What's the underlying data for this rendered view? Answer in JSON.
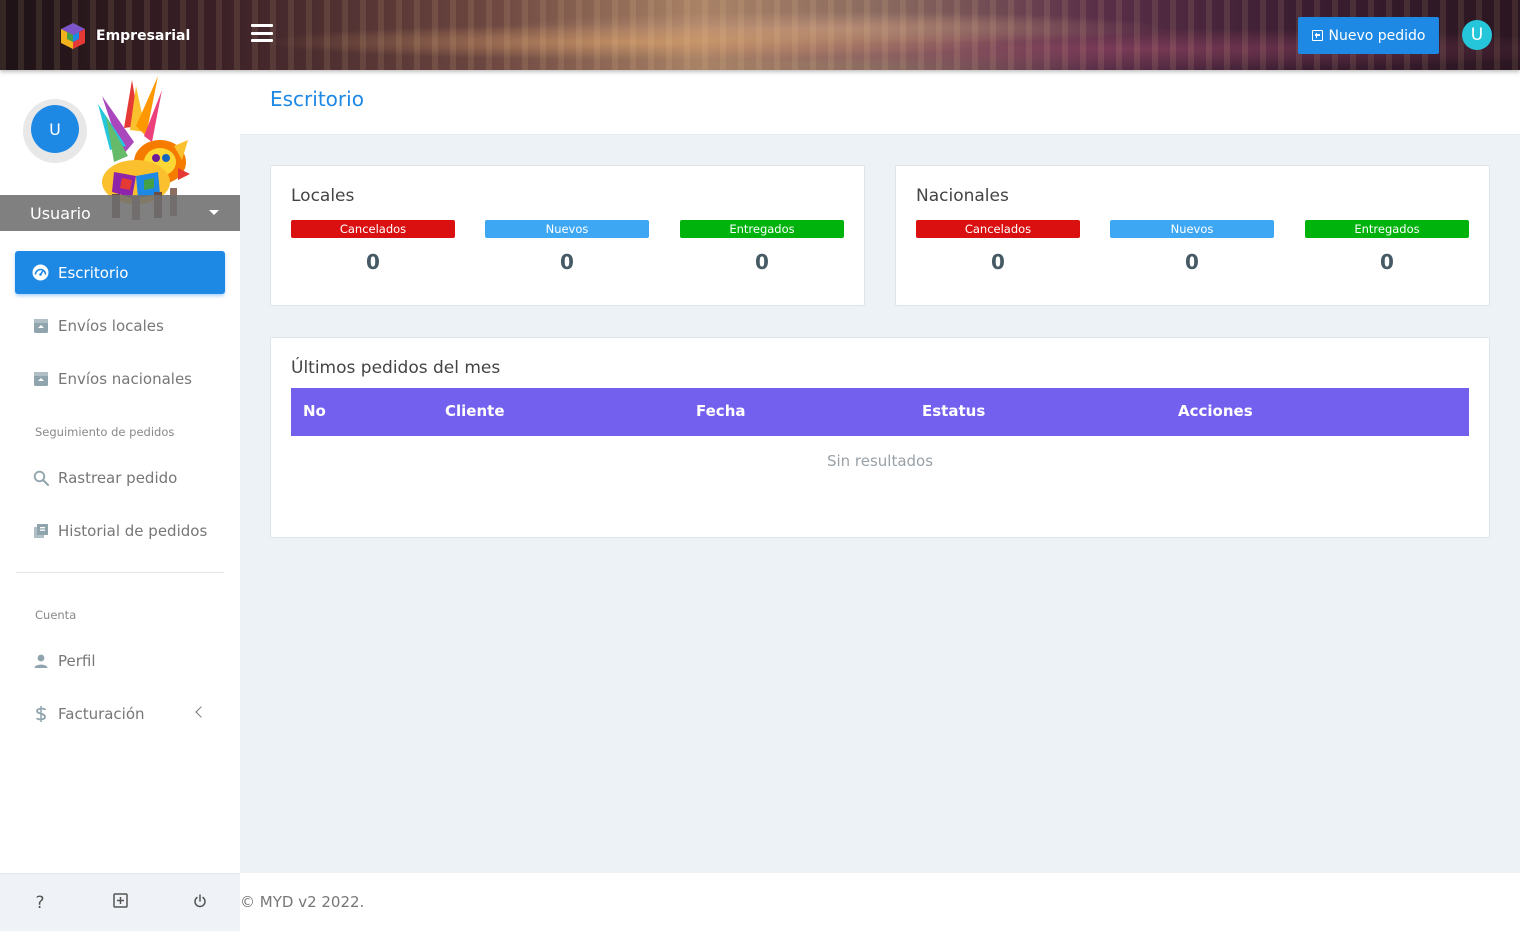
{
  "brand": {
    "name": "Empresarial"
  },
  "topbar": {
    "new_order_label": "Nuevo pedido",
    "user_initial": "U"
  },
  "sidebar": {
    "avatar_initial": "U",
    "user_name": "Usuario",
    "nav": [
      {
        "label": "Escritorio",
        "active": true
      },
      {
        "label": "Envíos locales"
      },
      {
        "label": "Envíos nacionales"
      }
    ],
    "section_tracking": "Seguimiento de pedidos",
    "tracking": [
      {
        "label": "Rastrear pedido"
      },
      {
        "label": "Historial de pedidos"
      }
    ],
    "section_account": "Cuenta",
    "account": [
      {
        "label": "Perfil"
      },
      {
        "label": "Facturación"
      }
    ],
    "footer": {
      "help_label": "?"
    }
  },
  "page": {
    "title": "Escritorio"
  },
  "locales": {
    "title": "Locales",
    "stats": [
      {
        "label": "Cancelados",
        "value": "0",
        "color": "#d90f10"
      },
      {
        "label": "Nuevos",
        "value": "0",
        "color": "#3ea7f3"
      },
      {
        "label": "Entregados",
        "value": "0",
        "color": "#00b30c"
      }
    ]
  },
  "nacionales": {
    "title": "Nacionales",
    "stats": [
      {
        "label": "Cancelados",
        "value": "0",
        "color": "#d90f10"
      },
      {
        "label": "Nuevos",
        "value": "0",
        "color": "#3ea7f3"
      },
      {
        "label": "Entregados",
        "value": "0",
        "color": "#00b30c"
      }
    ]
  },
  "orders": {
    "title": "Últimos pedidos del mes",
    "columns": [
      "No",
      "Cliente",
      "Fecha",
      "Estatus",
      "Acciones"
    ],
    "empty_text": "Sin resultados"
  },
  "footer": {
    "copyright": "© MYD v2 2022."
  },
  "colors": {
    "primary": "#1e88e5",
    "table_header": "#7460ee",
    "avatar_top": "#26c6da"
  }
}
